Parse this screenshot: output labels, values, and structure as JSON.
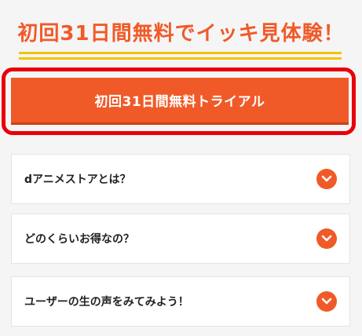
{
  "headline": "初回31日間無料でイッキ見体験！",
  "cta_button": "初回31日間無料トライアル",
  "faq": [
    {
      "question": "dアニメストアとは？",
      "icon": "chevron-down-icon"
    },
    {
      "question": "どのくらいお得なの？",
      "icon": "chevron-down-icon"
    },
    {
      "question": "ユーザーの生の声をみてみよう！",
      "icon": "chevron-down-icon"
    }
  ],
  "colors": {
    "accent": "#f05a28",
    "underline": "#f2c400",
    "highlight_border": "#e8000b",
    "card_bg": "#ffffff",
    "page_bg": "#f5f5f5"
  }
}
